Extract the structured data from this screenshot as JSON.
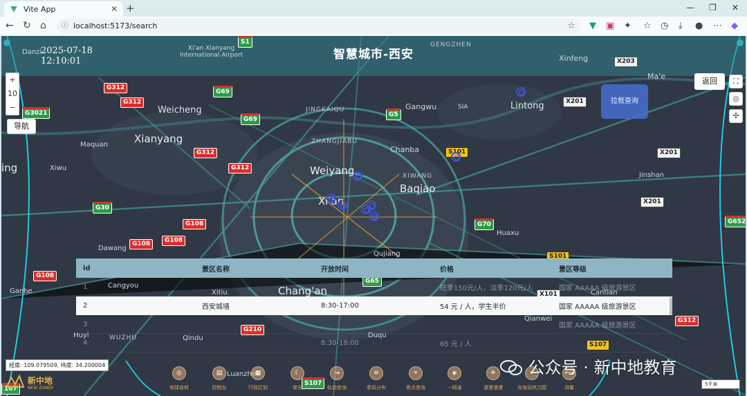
{
  "browser": {
    "tab_title": "Vite App",
    "url": "localhost:5173/search"
  },
  "header": {
    "title": "智慧城市-西安",
    "date": "2025-07-18",
    "time": "12:10:01"
  },
  "map": {
    "zoom_level": "10",
    "zoom_in": "+",
    "zoom_out": "−",
    "nav_button": "导航",
    "back_button": "返回",
    "list_button": "拉框查询",
    "coords": "经度: 109.079509, 纬度: 34.200004",
    "scale": "5千米",
    "labels": {
      "xianyang_airport": "Xi'an Xianyang\nInternational Airport",
      "gengzhen": "GENGZHEN",
      "xinfeng": "Xinfeng",
      "weicheng": "Weicheng",
      "xianyang": "Xianyang",
      "maquan": "Maquan",
      "xiwu": "Xiwu",
      "jingkaiqu": "JINGKAIQU",
      "zhangjiabu": "ZHANGJIABU",
      "gangwu": "Gangwu",
      "sia": "SIA",
      "lintong": "Lintong",
      "chanba": "Chanba",
      "weiyang": "Weiyang",
      "xiwang": "XIWANG",
      "baqiao": "Baqiao",
      "xian": "Xi'an",
      "jinshan": "Jinshan",
      "dawang": "Dawang",
      "huaxu": "Huaxu",
      "qujiang": "Qujiang",
      "cangyou": "Cangyou",
      "changan": "Chang'an",
      "xitiu": "Xitiu",
      "ganhe": "Ganhe",
      "cantian": "Cantian",
      "qianwei": "Qianwei",
      "huyi": "Huyi",
      "wuzhu": "WUZHU",
      "qindu": "Qindu",
      "duqu": "Duqu",
      "luanzhen": "Luanzhen",
      "mae": "Ma'e",
      "ing": "ing",
      "danzi": "Danzi"
    },
    "shields": {
      "s1": "S1",
      "x203": "X203",
      "g312a": "G312",
      "g312b": "G312",
      "g69a": "G69",
      "g3021": "G3021",
      "g5": "G5",
      "g69b": "G69",
      "x201a": "X201",
      "s101a": "S101",
      "g312c": "G312",
      "g312d": "G312",
      "x201b": "X201",
      "x201c": "X201",
      "g30": "G30",
      "g108a": "G108",
      "g108b": "G108",
      "g108c": "G108",
      "g70": "G70",
      "s101b": "S101",
      "g652": "G652",
      "g108d": "G108",
      "g210a": "G210",
      "g65": "G65",
      "x101": "X101",
      "g312e": "G312",
      "g210b": "G210",
      "s107a": "S107",
      "s107b": "S107",
      "g107": "107"
    }
  },
  "results": {
    "headers": [
      "id",
      "景区名称",
      "开放时间",
      "价格",
      "景区等级"
    ],
    "rows": [
      [
        "1",
        "",
        "",
        "旺季150元/人，淡季120元/人",
        "国家 AAAAA 级旅游景区"
      ],
      [
        "2",
        "西安城墙",
        "8:30-17:00",
        "54 元 / 人，学生半价",
        "国家 AAAAA 级旅游景区"
      ],
      [
        "3",
        "",
        "",
        "",
        "国家 AAAAA 级旅游景区"
      ],
      [
        "4",
        "",
        "8:30-18:00",
        "65 元 / 人",
        ""
      ]
    ]
  },
  "toolbar": {
    "items": [
      "地球自转",
      "控制台",
      "行政区划",
      "夜光",
      "轨迹查询",
      "季风分布",
      "景点查询",
      "一网通",
      "漫漫漫漫",
      "充电站热力图",
      "测量"
    ]
  },
  "logo": {
    "cn": "新中地",
    "en": "NEW ZONDY"
  },
  "watermark": {
    "text": "公众号 · 新中地教育"
  }
}
